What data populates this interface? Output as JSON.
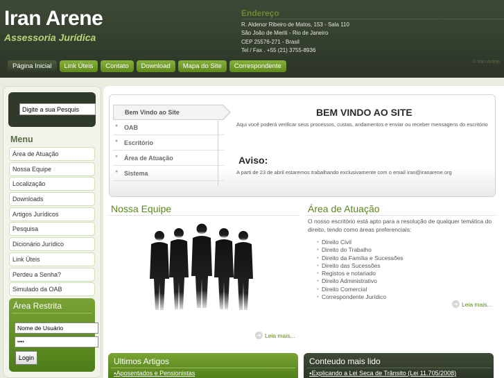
{
  "header": {
    "title": "Iran Arene",
    "subtitle": "Assessoria Jurídica",
    "address_title": "Endereço",
    "address_lines": [
      "R. Aldenor Ribeiro de Matos, 153 - Sala 110",
      "São João de Meriti - Rio de Janeiro",
      "CEP 25576-271 - Brasil",
      "Tel / Fax . +55 (21) 3755-8936"
    ],
    "top_link": "© Iran Arene"
  },
  "nav": [
    "Página Inicial",
    "Link Úteis",
    "Contato",
    "Download",
    "Mapa do Site",
    "Correspondente"
  ],
  "sidebar": {
    "search_value": "Digite a sua Pesquis",
    "menu_title": "Menu",
    "menu_items": [
      "Área de Atuação",
      "Nossa Equipe",
      "Localização",
      "Downloads",
      "Artigos Jurídicos",
      "Pesquisa",
      "Dicionário Jurídico",
      "Link Úteis",
      "Perdeu a Senha?",
      "Simulado da OAB"
    ],
    "restrita_title": "Área Restrita",
    "user_value": "Nome de Usuário",
    "pass_value": "••••",
    "login_label": "Login"
  },
  "welcome": {
    "tabs": [
      "Bem Vindo ao Site",
      "OAB",
      "Escritório",
      "Área de Atuação",
      "Sistema"
    ],
    "title": "BEM VINDO AO SITE",
    "text": "Aqui você poderá verificar seus processos, custas, andamentos e enviar ou receber mensagens do escritório",
    "aviso_title": "Aviso:",
    "aviso_text": "A parti de 23 de abril estaremos trabalhando exclusivamente com o email iran@iranarene.org"
  },
  "equipe": {
    "title": "Nossa Equipe",
    "leia": "Leia mais..."
  },
  "area": {
    "title": "Área de Atuação",
    "text": "O nosso escritório está apto para a resolução de qualquer temática do direito, tendo como áreas preferenciais:",
    "items": [
      "Direito Civil",
      "Direito do Trabalho",
      "Direito da Família e Sucessões",
      "Direito das Sucessões",
      "Registos e notariado",
      "Direito Administrativo",
      "Direito Comercial",
      "Correspondente Jurídico"
    ],
    "leia": "Leia mais..."
  },
  "artigos": {
    "title": "Ultimos Artigos",
    "link": "Aposentados e Pensionistas"
  },
  "conteudo": {
    "title": "Conteudo mais lido",
    "link": "Explicando a Lei Seca de Trânsito (Lei 11.705/2008)"
  }
}
